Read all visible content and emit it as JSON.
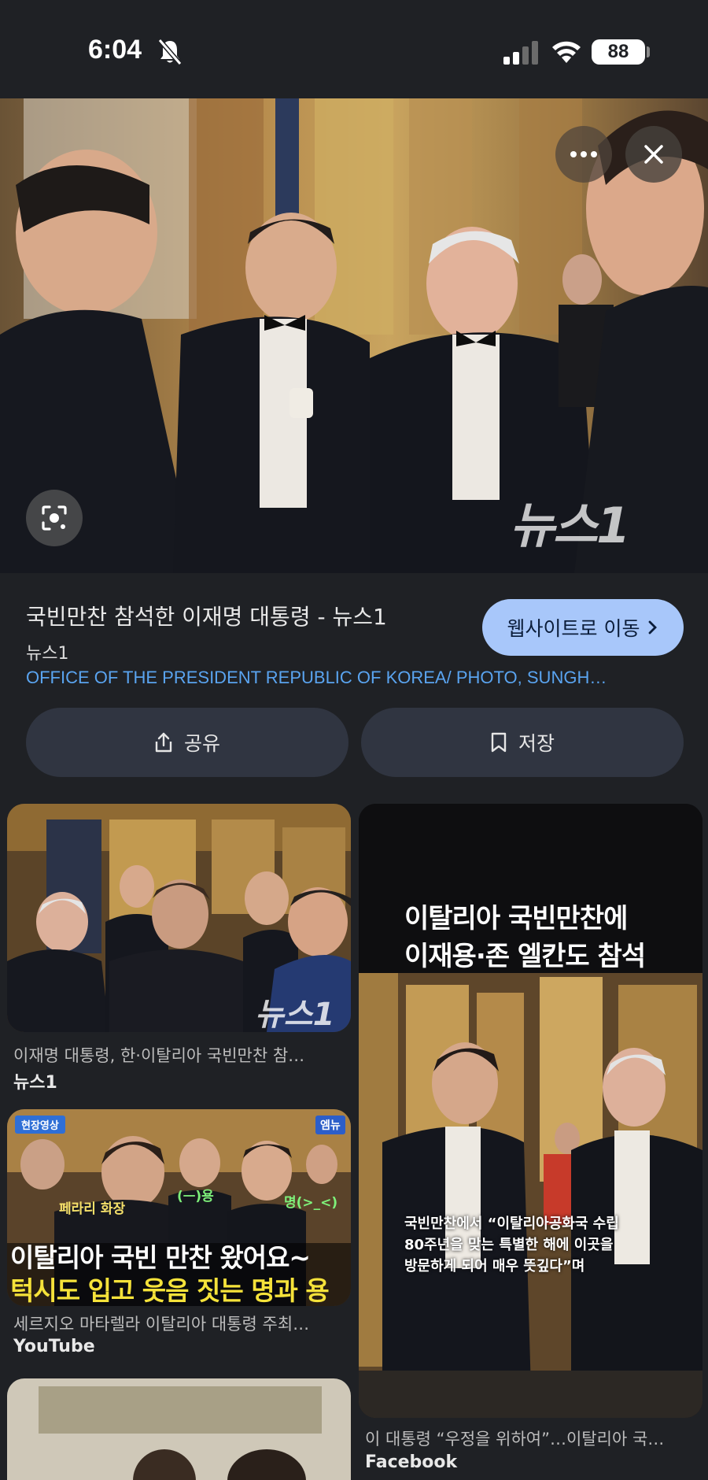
{
  "status_bar": {
    "time": "6:04",
    "battery": "88"
  },
  "hero": {
    "watermark": "뉴스1"
  },
  "result": {
    "title": "국빈만찬 참석한 이재명 대통령 - 뉴스1",
    "source": "뉴스1",
    "credit": "OFFICE OF THE PRESIDENT REPUBLIC OF KOREA/ PHOTO, SUNGH…",
    "visit_label": "웹사이트로 이동",
    "share_label": "공유",
    "save_label": "저장"
  },
  "related": [
    {
      "caption": "이재명 대통령, 한·이탈리아 국빈만찬 참…",
      "source": "뉴스1",
      "watermark": "뉴스1"
    },
    {
      "caption": "세르지오 마타렐라 이탈리아 대통령 주최…",
      "source": "YouTube",
      "badge_left": "현장영상",
      "badge_right": "엠뉴",
      "tag_a": "페라리 화장",
      "tag_b": "(ᅳ)용",
      "tag_c": "명(>_<)",
      "line1": "이탈리아 국빈 만찬 왔어요~",
      "line2": "턱시도 입고 웃음 짓는 명과 용"
    },
    {
      "caption": "이 대통령 “우정을 위하여”…이탈리아 국…",
      "source": "Facebook",
      "headline1": "이탈리아 국빈만찬에",
      "headline2": "이재용·존 엘칸도 참석",
      "quote1": "국빈만찬에서 “이탈리아공화국 수립",
      "quote2": "80주년을 맞는 특별한 해에 이곳을",
      "quote3": "방문하게 되어 매우 뜻깊다”며"
    }
  ],
  "colors": {
    "background": "#1f2125",
    "accent_link": "#5aa4f0",
    "visit_button": "#a8c7fa",
    "action_button": "#303541"
  },
  "icons": [
    "bell-slash-icon",
    "cellular-signal-icon",
    "wifi-icon",
    "more-icon",
    "close-icon",
    "lens-icon",
    "share-icon",
    "bookmark-icon",
    "chevron-right-icon"
  ]
}
